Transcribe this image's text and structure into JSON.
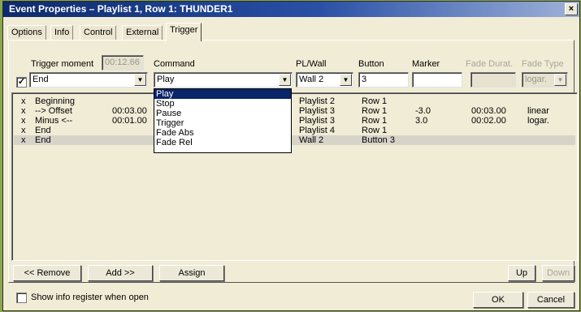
{
  "window": {
    "title": "Event Properties – Playlist 1, Row 1: THUNDER1",
    "close_glyph": "×"
  },
  "tabs": [
    {
      "label": "Options"
    },
    {
      "label": "Info"
    },
    {
      "label": "Control"
    },
    {
      "label": "External"
    },
    {
      "label": "Trigger",
      "active": true
    }
  ],
  "trigger": {
    "moment_label": "Trigger moment",
    "moment_time": "00:12.66",
    "moment_value": "End",
    "moment_checked": true,
    "command_label": "Command",
    "command_value": "Play",
    "plwall_label": "PL/Wall",
    "plwall_value": "Wall 2",
    "button_label": "Button",
    "button_value": "3",
    "marker_label": "Marker",
    "marker_value": "",
    "fade_dur_label": "Fade Durat.",
    "fade_dur_value": "",
    "fade_type_label": "Fade Type",
    "fade_type_value": "logar."
  },
  "command_menu": {
    "items": [
      "Play",
      "Stop",
      "Pause",
      "Trigger",
      "Fade Abs",
      "Fade Rel"
    ],
    "highlighted": 0
  },
  "rows": [
    {
      "x": "x",
      "moment": "Beginning",
      "time": "",
      "command": "",
      "plwall": "Playlist 2",
      "button": "Row 1",
      "marker": "",
      "fade_dur": "",
      "fade_type": ""
    },
    {
      "x": "x",
      "moment": "--> Offset",
      "time": "00:03.00",
      "command": "",
      "plwall": "Playlist 3",
      "button": "Row 1",
      "marker": "-3.0",
      "fade_dur": "00:03.00",
      "fade_type": "linear"
    },
    {
      "x": "x",
      "moment": "Minus <--",
      "time": "00:01.00",
      "command": "",
      "plwall": "Playlist 3",
      "button": "Row 1",
      "marker": "3.0",
      "fade_dur": "00:02.00",
      "fade_type": "logar."
    },
    {
      "x": "x",
      "moment": "End",
      "time": "",
      "command": "",
      "plwall": "Playlist 4",
      "button": "Row 1",
      "marker": "",
      "fade_dur": "",
      "fade_type": ""
    },
    {
      "x": "x",
      "moment": "End",
      "time": "",
      "command": "",
      "plwall": "Wall 2",
      "button": "Button 3",
      "marker": "",
      "fade_dur": "",
      "fade_type": "",
      "selected": true
    }
  ],
  "buttons": {
    "remove": "<< Remove",
    "add": "Add >>",
    "assign": "Assign",
    "up": "Up",
    "down": "Down",
    "ok": "OK",
    "cancel": "Cancel"
  },
  "footer": {
    "show_info_label": "Show info register when open",
    "show_info_checked": false
  },
  "icons": {
    "dropdown": "▼",
    "check": "✓"
  }
}
